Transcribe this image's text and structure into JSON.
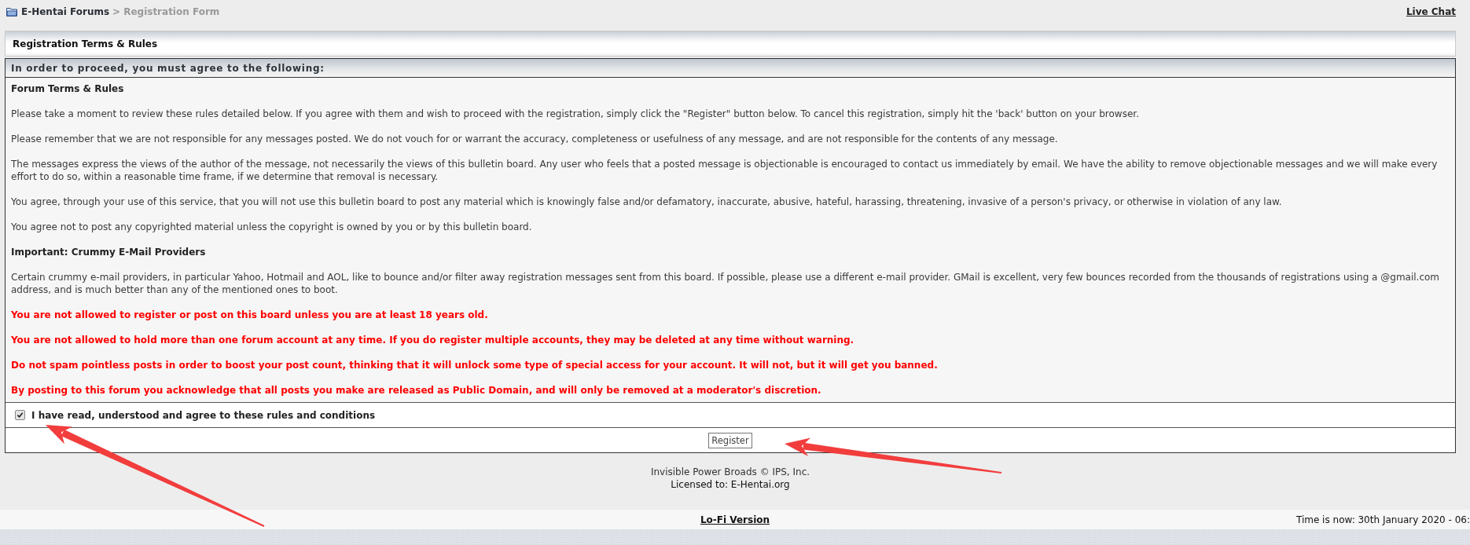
{
  "breadcrumb": {
    "items": [
      {
        "label": "E-Hentai Forums",
        "kind": "link"
      },
      {
        "label": "Registration Form",
        "kind": "current"
      }
    ],
    "separator": ">"
  },
  "top_links": [
    {
      "label": "Live Chat"
    }
  ],
  "panel_title": "Registration Terms & Rules",
  "terms": {
    "heading": "In order to proceed, you must agree to the following:",
    "blocks": [
      {
        "kind": "heading",
        "text": "Forum Terms & Rules"
      },
      {
        "kind": "paragraph",
        "text": "Please take a moment to review these rules detailed below. If you agree with them and wish to proceed with the registration, simply click the \"Register\" button below. To cancel this registration, simply hit the 'back' button on your browser."
      },
      {
        "kind": "paragraph",
        "text": "Please remember that we are not responsible for any messages posted. We do not vouch for or warrant the accuracy, completeness or usefulness of any message, and are not responsible for the contents of any message."
      },
      {
        "kind": "paragraph",
        "text": "The messages express the views of the author of the message, not necessarily the views of this bulletin board. Any user who feels that a posted message is objectionable is encouraged to contact us immediately by email. We have the ability to remove objectionable messages and we will make every effort to do so, within a reasonable time frame, if we determine that removal is necessary."
      },
      {
        "kind": "paragraph",
        "text": "You agree, through your use of this service, that you will not use this bulletin board to post any material which is knowingly false and/or defamatory, inaccurate, abusive, hateful, harassing, threatening, invasive of a person's privacy, or otherwise in violation of any law."
      },
      {
        "kind": "paragraph",
        "text": "You agree not to post any copyrighted material unless the copyright is owned by you or by this bulletin board."
      },
      {
        "kind": "heading",
        "text": "Important: Crummy E-Mail Providers"
      },
      {
        "kind": "paragraph",
        "text": "Certain crummy e-mail providers, in particular Yahoo, Hotmail and AOL, like to bounce and/or filter away registration messages sent from this board. If possible, please use a different e-mail provider. GMail is excellent, very few bounces recorded from the thousands of registrations using a @gmail.com address, and is much better than any of the mentioned ones to boot."
      },
      {
        "kind": "warning",
        "text": "You are not allowed to register or post on this board unless you are at least 18 years old."
      },
      {
        "kind": "warning",
        "text": "You are not allowed to hold more than one forum account at any time. If you do register multiple accounts, they may be deleted at any time without warning."
      },
      {
        "kind": "warning",
        "text": "Do not spam pointless posts in order to boost your post count, thinking that it will unlock some type of special access for your account. It will not, but it will get you banned."
      },
      {
        "kind": "warning",
        "text": "By posting to this forum you acknowledge that all posts you make are released as Public Domain, and will only be removed at a moderator's discretion."
      }
    ]
  },
  "agreement": {
    "label": "I have read, understood and agree to these rules and conditions",
    "checked": true
  },
  "register_button": "Register",
  "footer": {
    "lines": [
      "Invisible Power Broads © IPS, Inc.",
      "Licensed to: E-Hentai.org"
    ]
  },
  "bottom_bar": {
    "lofi_link": "Lo-Fi Version",
    "time": "Time is now: 30th January 2020 - 06:"
  },
  "annotations": [
    {
      "kind": "arrow"
    },
    {
      "kind": "arrow"
    }
  ]
}
